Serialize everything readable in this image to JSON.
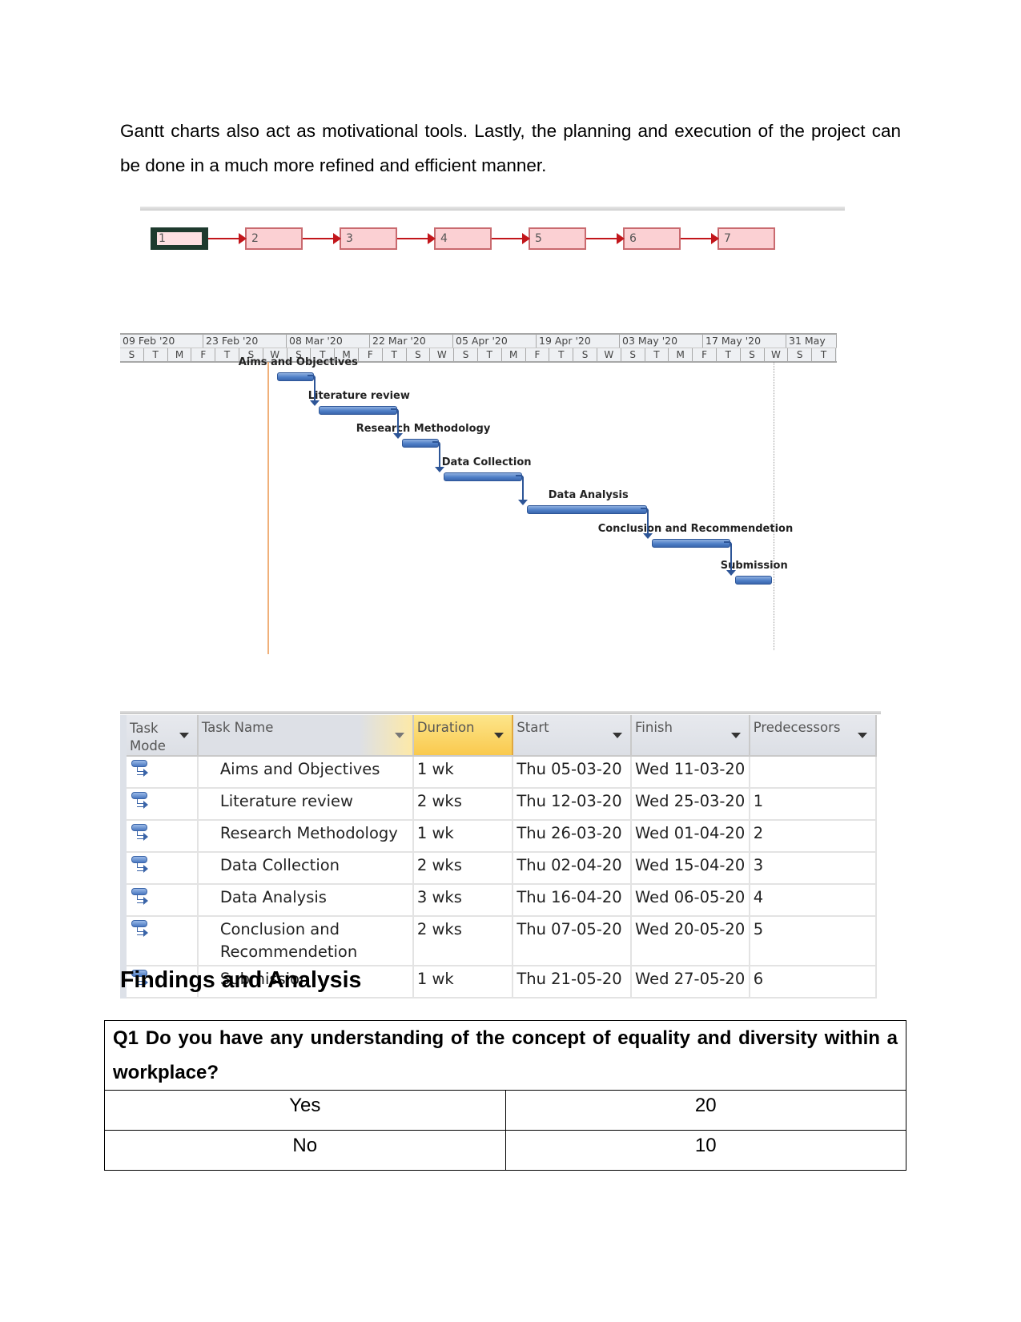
{
  "intro_paragraph": "Gantt charts also act as motivational tools. Lastly, the planning and execution of the project can be done in a much more refined and efficient manner.",
  "network_diagram": {
    "nodes": [
      "1",
      "2",
      "3",
      "4",
      "5",
      "6",
      "7"
    ],
    "selected_node": "1",
    "colors": {
      "node_fill": "#fbd0d3",
      "node_border": "#c96a6f",
      "link": "#c2161b"
    }
  },
  "chart_data": {
    "type": "gantt",
    "title": "",
    "timescale": {
      "major_ticks": [
        "09 Feb '20",
        "23 Feb '20",
        "08 Mar '20",
        "22 Mar '20",
        "05 Apr '20",
        "19 Apr '20",
        "03 May '20",
        "17 May '20",
        "31 May"
      ],
      "minor_ticks": [
        "S",
        "T",
        "M",
        "F",
        "T",
        "S",
        "W",
        "S",
        "T",
        "M",
        "F",
        "T",
        "S",
        "W",
        "S",
        "T",
        "M",
        "F",
        "T",
        "S",
        "W",
        "S",
        "T",
        "M",
        "F",
        "T",
        "S",
        "W",
        "S",
        "T"
      ]
    },
    "tasks": [
      {
        "id": 1,
        "name": "Aims and Objectives",
        "start": "2020-03-05",
        "finish": "2020-03-11",
        "predecessor": null
      },
      {
        "id": 2,
        "name": "Literature review",
        "start": "2020-03-12",
        "finish": "2020-03-25",
        "predecessor": 1
      },
      {
        "id": 3,
        "name": "Research Methodology",
        "start": "2020-03-26",
        "finish": "2020-04-01",
        "predecessor": 2
      },
      {
        "id": 4,
        "name": "Data Collection",
        "start": "2020-04-02",
        "finish": "2020-04-15",
        "predecessor": 3
      },
      {
        "id": 5,
        "name": "Data Analysis",
        "start": "2020-04-16",
        "finish": "2020-05-06",
        "predecessor": 4
      },
      {
        "id": 6,
        "name": "Conclusion and Recommendetion",
        "start": "2020-05-07",
        "finish": "2020-05-20",
        "predecessor": 5
      },
      {
        "id": 7,
        "name": "Submission",
        "start": "2020-05-21",
        "finish": "2020-05-27",
        "predecessor": 6
      }
    ],
    "bar_color": "#4f7fc7",
    "range": [
      "2020-02-09",
      "2020-06-01"
    ]
  },
  "task_sheet": {
    "columns": {
      "mode": "Task Mode",
      "name": "Task Name",
      "duration": "Duration",
      "start": "Start",
      "finish": "Finish",
      "predecessors": "Predecessors"
    },
    "rows": [
      {
        "name": "Aims and Objectives",
        "duration": "1 wk",
        "start": "Thu 05-03-20",
        "finish": "Wed 11-03-20",
        "predecessors": ""
      },
      {
        "name": "Literature review",
        "duration": "2 wks",
        "start": "Thu 12-03-20",
        "finish": "Wed 25-03-20",
        "predecessors": "1"
      },
      {
        "name": "Research Methodology",
        "duration": "1 wk",
        "start": "Thu 26-03-20",
        "finish": "Wed 01-04-20",
        "predecessors": "2"
      },
      {
        "name": "Data Collection",
        "duration": "2 wks",
        "start": "Thu 02-04-20",
        "finish": "Wed 15-04-20",
        "predecessors": "3"
      },
      {
        "name": "Data Analysis",
        "duration": "3 wks",
        "start": "Thu 16-04-20",
        "finish": "Wed 06-05-20",
        "predecessors": "4"
      },
      {
        "name": "Conclusion and Recommendetion",
        "duration": "2 wks",
        "start": "Thu 07-05-20",
        "finish": "Wed 20-05-20",
        "predecessors": "5"
      },
      {
        "name": "Submission",
        "duration": "1 wk",
        "start": "Thu 21-05-20",
        "finish": "Wed 27-05-20",
        "predecessors": "6"
      }
    ]
  },
  "findings": {
    "heading": "Findings and Analysis",
    "question": "Q1 Do you have any understanding of the concept of equality and diversity within a workplace?",
    "answers": [
      {
        "label": "Yes",
        "count": "20"
      },
      {
        "label": "No",
        "count": "10"
      }
    ]
  }
}
